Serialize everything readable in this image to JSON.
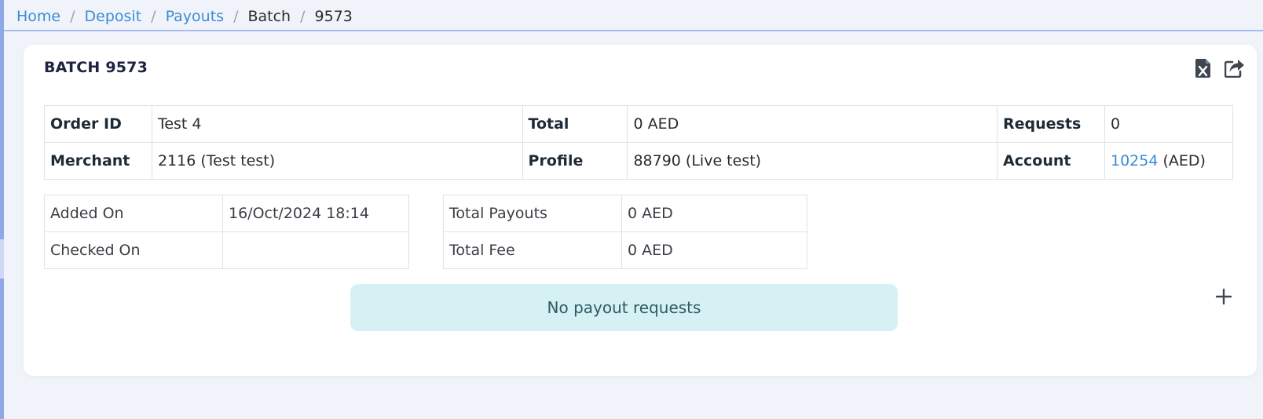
{
  "breadcrumb": [
    {
      "label": "Home",
      "link": true
    },
    {
      "label": "Deposit",
      "link": true
    },
    {
      "label": "Payouts",
      "link": true
    },
    {
      "label": "Batch",
      "link": false
    },
    {
      "label": "9573",
      "link": false
    }
  ],
  "card": {
    "title": "BATCH 9573",
    "actions": [
      "excel-export-icon",
      "share-export-icon"
    ]
  },
  "info": {
    "order_id_label": "Order ID",
    "order_id_value": "Test 4",
    "total_label": "Total",
    "total_value": "0 AED",
    "requests_label": "Requests",
    "requests_value": "0",
    "merchant_label": "Merchant",
    "merchant_value": "2116 (Test test)",
    "profile_label": "Profile",
    "profile_value": "88790 (Live test)",
    "account_label": "Account",
    "account_id": "10254",
    "account_currency": "(AED)"
  },
  "dates": {
    "added_on_label": "Added On",
    "added_on_value": "16/Oct/2024 18:14",
    "checked_on_label": "Checked On",
    "checked_on_value": ""
  },
  "totals": {
    "total_payouts_label": "Total Payouts",
    "total_payouts_value": "0 AED",
    "total_fee_label": "Total Fee",
    "total_fee_value": "0 AED"
  },
  "empty_message": "No payout requests",
  "colors": {
    "link": "#3d8bd4",
    "alert_bg": "#d6f1f4",
    "title": "#1d2340"
  }
}
